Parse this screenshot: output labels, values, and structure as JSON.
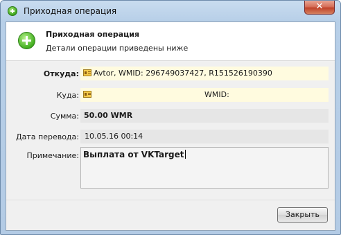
{
  "window": {
    "title": "Приходная операция",
    "close_symbol": "✕"
  },
  "header": {
    "title": "Приходная операция",
    "subtitle": "Детали операции приведены ниже",
    "icon": "green-plus-icon"
  },
  "fields": {
    "from_label": "Откуда:",
    "from_value": "Avtor, WMID: 296749037427, R151526190390",
    "to_label": "Куда:",
    "to_value": "WMID:",
    "amount_label": "Сумма:",
    "amount_value": "50.00 WMR",
    "date_label": "Дата перевода:",
    "date_value": "10.05.16 00:14",
    "note_label": "Примечание:",
    "note_value": "Выплата от VKTarget"
  },
  "buttons": {
    "close_label": "Закрыть"
  },
  "colors": {
    "titlebar": "#b7cfe8",
    "field_yellow": "#fffbdf",
    "field_gray": "#e6e6e6",
    "close_red": "#c0432a"
  }
}
